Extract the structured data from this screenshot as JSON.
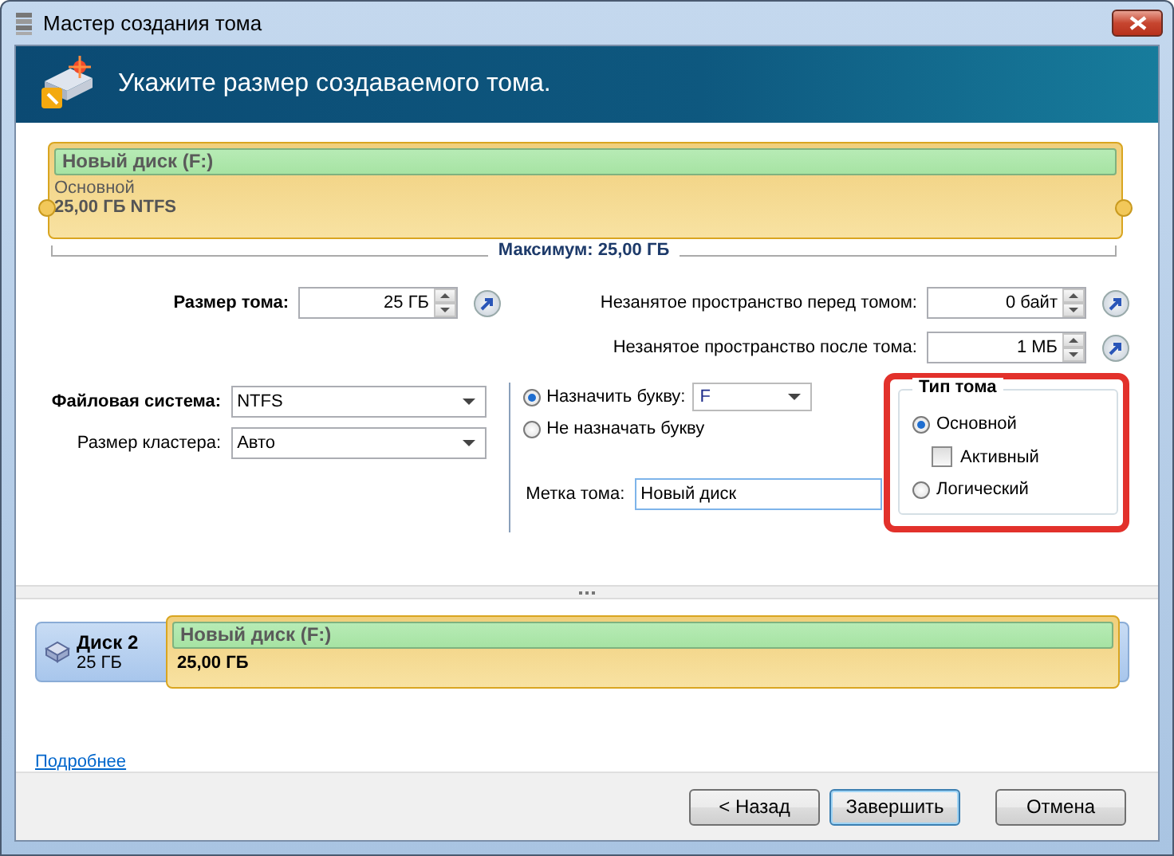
{
  "window": {
    "title": "Мастер создания тома"
  },
  "header": {
    "title": "Укажите размер создаваемого тома."
  },
  "partition": {
    "name": "Новый диск (F:)",
    "type": "Основной",
    "details": "25,00 ГБ NTFS"
  },
  "maximum": "Максимум: 25,00 ГБ",
  "size": {
    "label": "Размер тома:",
    "value": "25 ГБ"
  },
  "free_before": {
    "label": "Незанятое пространство перед томом:",
    "value": "0 байт"
  },
  "free_after": {
    "label": "Незанятое пространство после тома:",
    "value": "1 МБ"
  },
  "file_system": {
    "label": "Файловая система:",
    "value": "NTFS"
  },
  "cluster": {
    "label": "Размер кластера:",
    "value": "Авто"
  },
  "letter_options": [
    {
      "label": "Назначить букву:",
      "selected": true,
      "value": "F"
    },
    {
      "label": "Не назначать букву",
      "selected": false
    }
  ],
  "volume_label": {
    "label": "Метка тома:",
    "value": "Новый диск"
  },
  "volume_type": {
    "title": "Тип тома",
    "options": [
      {
        "kind": "radio",
        "label": "Основной",
        "selected": true
      },
      {
        "kind": "checkbox",
        "label": "Активный",
        "checked": false
      },
      {
        "kind": "radio",
        "label": "Логический",
        "selected": false
      }
    ]
  },
  "disk_map": {
    "disk": "Диск 2",
    "disk_size": "25 ГБ",
    "partition": "Новый диск (F:)",
    "partition_size": "25,00 ГБ"
  },
  "link": "Подробнее",
  "buttons": [
    {
      "label": "< Назад",
      "kind": "normal"
    },
    {
      "label": "Завершить",
      "kind": "default"
    },
    {
      "label": "Отмена",
      "kind": "normal"
    }
  ]
}
